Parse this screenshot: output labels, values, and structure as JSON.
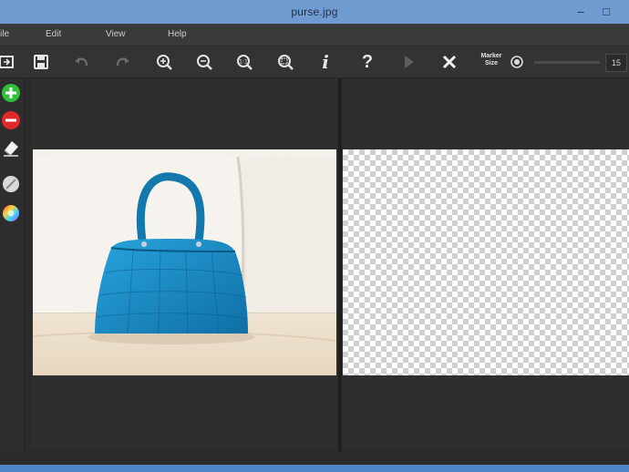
{
  "window": {
    "title": "purse.jpg",
    "minimize": "–",
    "maximize": "□"
  },
  "menu": {
    "items": [
      {
        "label": "File"
      },
      {
        "label": "Edit"
      },
      {
        "label": "View"
      },
      {
        "label": "Help"
      }
    ]
  },
  "toolbar": {
    "icons": [
      "open-icon",
      "save-icon",
      "undo-icon",
      "redo-icon",
      "zoom-in-icon",
      "zoom-out-icon",
      "zoom-actual-icon",
      "zoom-fit-icon",
      "info-icon",
      "help-icon",
      "play-icon",
      "close-x-icon"
    ],
    "info_glyph": "i",
    "help_glyph": "?",
    "marker_size_label": "Marker Size",
    "marker_size_value": "15"
  },
  "sidebar": {
    "tools": [
      "add-marker-icon",
      "remove-marker-icon",
      "eraser-icon",
      "brush-icon",
      "color-wheel-icon"
    ]
  },
  "colors": {
    "titlebar": "#6f9bd1",
    "panel": "#2e2e2e",
    "add": "#2fbf3a",
    "remove": "#e02a2a",
    "bag": "#1a86bf"
  }
}
